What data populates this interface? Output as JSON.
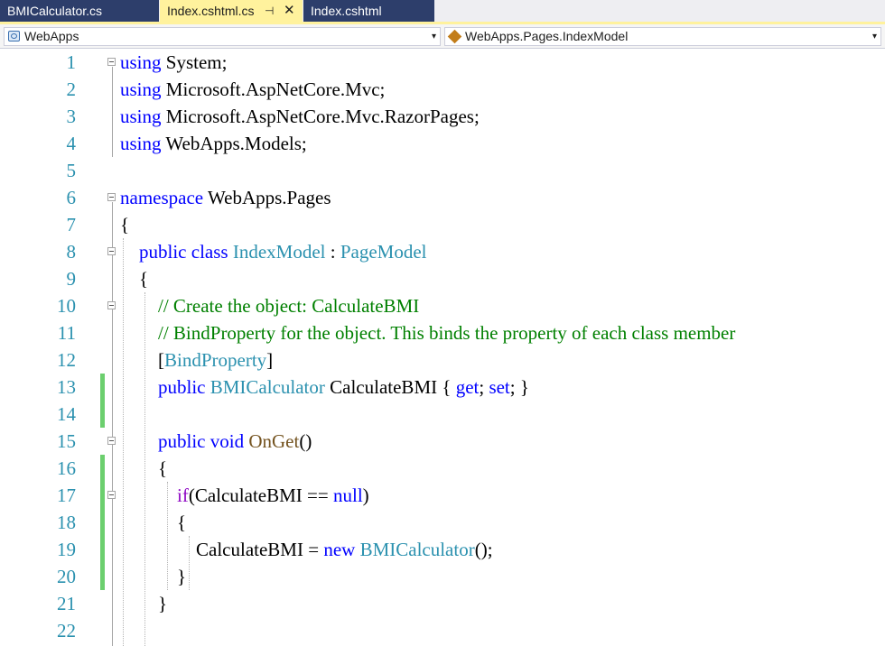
{
  "tabs": [
    {
      "label": "BMICalculator.cs",
      "active": false
    },
    {
      "label": "Index.cshtml.cs",
      "active": true,
      "pin_glyph": "⊣",
      "close_glyph": "✕"
    },
    {
      "label": "Index.cshtml",
      "active": false
    }
  ],
  "navbar": {
    "project": "WebApps",
    "type": "WebApps.Pages.IndexModel",
    "dropdown_glyph": "▾"
  },
  "colors": {
    "active_tab": "#fff29d",
    "inactive_tab": "#2d3e6b",
    "keyword": "#0000ff",
    "type": "#2b91af",
    "comment": "#008000",
    "control_keyword": "#8f08c4",
    "method": "#74531f",
    "line_number": "#2b91af",
    "change_marker": "#6ccf6e"
  },
  "editor": {
    "lines": [
      {
        "n": "1",
        "indent": "",
        "tokens": [
          {
            "t": "using",
            "c": "kw"
          },
          {
            "t": " System;"
          }
        ]
      },
      {
        "n": "2",
        "indent": "",
        "tokens": [
          {
            "t": "using",
            "c": "kw"
          },
          {
            "t": " Microsoft.AspNetCore.Mvc;"
          }
        ]
      },
      {
        "n": "3",
        "indent": "",
        "tokens": [
          {
            "t": "using",
            "c": "kw"
          },
          {
            "t": " Microsoft.AspNetCore.Mvc.RazorPages;"
          }
        ]
      },
      {
        "n": "4",
        "indent": "",
        "tokens": [
          {
            "t": "using",
            "c": "kw"
          },
          {
            "t": " WebApps.Models;"
          }
        ]
      },
      {
        "n": "5",
        "indent": "",
        "tokens": []
      },
      {
        "n": "6",
        "indent": "",
        "tokens": [
          {
            "t": "namespace",
            "c": "kw"
          },
          {
            "t": " WebApps.Pages"
          }
        ]
      },
      {
        "n": "7",
        "indent": "",
        "tokens": [
          {
            "t": "{"
          }
        ]
      },
      {
        "n": "8",
        "indent": "    ",
        "tokens": [
          {
            "t": "public",
            "c": "kw"
          },
          {
            "t": " "
          },
          {
            "t": "class",
            "c": "kw"
          },
          {
            "t": " "
          },
          {
            "t": "IndexModel",
            "c": "ty"
          },
          {
            "t": " : "
          },
          {
            "t": "PageModel",
            "c": "ty"
          }
        ]
      },
      {
        "n": "9",
        "indent": "    ",
        "tokens": [
          {
            "t": "{"
          }
        ]
      },
      {
        "n": "10",
        "indent": "        ",
        "tokens": [
          {
            "t": "// Create the object: CalculateBMI",
            "c": "cm"
          }
        ]
      },
      {
        "n": "11",
        "indent": "        ",
        "tokens": [
          {
            "t": "// BindProperty for the object. This binds the property of each class member",
            "c": "cm"
          }
        ]
      },
      {
        "n": "12",
        "indent": "        ",
        "tokens": [
          {
            "t": "["
          },
          {
            "t": "BindProperty",
            "c": "ty"
          },
          {
            "t": "]"
          }
        ]
      },
      {
        "n": "13",
        "indent": "        ",
        "tokens": [
          {
            "t": "public",
            "c": "kw"
          },
          {
            "t": " "
          },
          {
            "t": "BMICalculator",
            "c": "ty"
          },
          {
            "t": " CalculateBMI { "
          },
          {
            "t": "get",
            "c": "kw"
          },
          {
            "t": "; "
          },
          {
            "t": "set",
            "c": "kw"
          },
          {
            "t": "; }"
          }
        ]
      },
      {
        "n": "14",
        "indent": "",
        "tokens": []
      },
      {
        "n": "15",
        "indent": "        ",
        "tokens": [
          {
            "t": "public",
            "c": "kw"
          },
          {
            "t": " "
          },
          {
            "t": "void",
            "c": "kw"
          },
          {
            "t": " "
          },
          {
            "t": "OnGet",
            "c": "mt"
          },
          {
            "t": "()"
          }
        ]
      },
      {
        "n": "16",
        "indent": "        ",
        "tokens": [
          {
            "t": "{"
          }
        ]
      },
      {
        "n": "17",
        "indent": "            ",
        "tokens": [
          {
            "t": "if",
            "c": "ctl"
          },
          {
            "t": "(CalculateBMI == "
          },
          {
            "t": "null",
            "c": "kw"
          },
          {
            "t": ")"
          }
        ]
      },
      {
        "n": "18",
        "indent": "            ",
        "tokens": [
          {
            "t": "{"
          }
        ]
      },
      {
        "n": "19",
        "indent": "                ",
        "tokens": [
          {
            "t": "CalculateBMI = "
          },
          {
            "t": "new",
            "c": "kw"
          },
          {
            "t": " "
          },
          {
            "t": "BMICalculator",
            "c": "ty"
          },
          {
            "t": "();"
          }
        ]
      },
      {
        "n": "20",
        "indent": "            ",
        "tokens": [
          {
            "t": "}"
          }
        ]
      },
      {
        "n": "21",
        "indent": "        ",
        "tokens": [
          {
            "t": "}"
          }
        ]
      },
      {
        "n": "22",
        "indent": "",
        "tokens": []
      }
    ]
  }
}
